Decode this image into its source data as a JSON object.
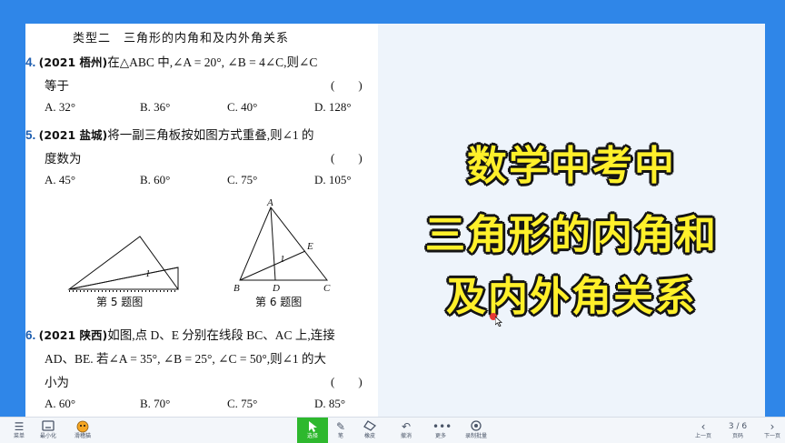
{
  "document": {
    "title": "类型二　三角形的内角和及内外角关系",
    "q4": {
      "num": "4.",
      "source": "(2021 梧州)",
      "text1": "在△ABC 中,∠A = 20°, ∠B = 4∠C,则∠C",
      "text2": "等于",
      "paren": "(　　)",
      "options": [
        "A. 32°",
        "B. 36°",
        "C. 40°",
        "D. 128°"
      ]
    },
    "q5": {
      "num": "5.",
      "source": "(2021 盐城)",
      "text1": "将一副三角板按如图方式重叠,则∠1 的",
      "text2": "度数为",
      "paren": "(　　)",
      "options": [
        "A. 45°",
        "B. 60°",
        "C. 75°",
        "D. 105°"
      ]
    },
    "fig5": {
      "caption": "第 5 题图",
      "angle_label": "1"
    },
    "fig6": {
      "caption": "第 6 题图",
      "labels": {
        "A": "A",
        "B": "B",
        "C": "C",
        "D": "D",
        "E": "E",
        "angle": "1"
      }
    },
    "q6": {
      "num": "6.",
      "source": "(2021 陕西)",
      "text1": "如图,点 D、E 分别在线段 BC、AC 上,连接",
      "text2": "AD、BE. 若∠A = 35°, ∠B = 25°, ∠C = 50°,则∠1 的大",
      "text3": "小为",
      "paren": "(　　)",
      "options": [
        "A. 60°",
        "B. 70°",
        "C. 75°",
        "D. 85°"
      ]
    }
  },
  "promo": {
    "lines": [
      "数学中考中",
      "三角形的内角和",
      "及内外角关系"
    ],
    "color": "#fff02a",
    "outline": "#141414"
  },
  "toolbar": {
    "left": [
      {
        "icon": "menu-icon",
        "label": "菜单"
      },
      {
        "icon": "minimize-icon",
        "label": "最小化"
      },
      {
        "icon": "mascot-icon",
        "label": "滑稽猫"
      }
    ],
    "center": [
      {
        "icon": "select-arrow-icon",
        "label": "选择",
        "active": true
      },
      {
        "icon": "pen-icon",
        "label": "笔"
      },
      {
        "icon": "eraser-icon",
        "label": "橡皮"
      },
      {
        "icon": "undo-icon",
        "label": "撤消"
      },
      {
        "icon": "more-icon",
        "label": "更多"
      },
      {
        "icon": "record-icon",
        "label": "录制批量"
      }
    ],
    "pager": {
      "prev_label": "上一页",
      "page": "3 / 6",
      "page_label": "页码",
      "next_label": "下一页"
    }
  },
  "colors": {
    "background": "#2f86e8",
    "slide": "#eef4fb",
    "active_tool": "#2eb82e",
    "cursor_dot": "#e53935"
  }
}
